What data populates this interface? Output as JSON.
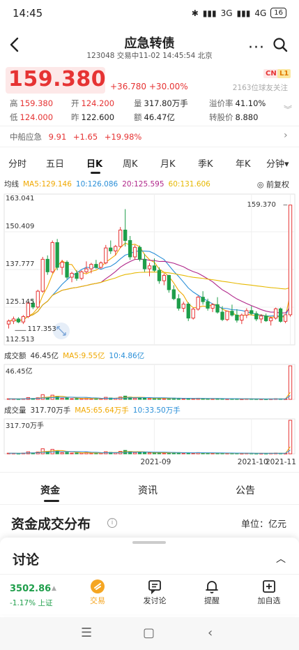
{
  "status_bar": {
    "time": "14:45",
    "network": "3G",
    "network2": "4G",
    "battery": "16"
  },
  "header": {
    "title": "应急转债",
    "subtitle": "123048 交易中11-02 14:45:54 北京"
  },
  "quote": {
    "price": "159.380",
    "change": "+36.780",
    "change_pct": "+30.00%",
    "tag_cn": "CN",
    "tag_l1": "L1",
    "followers": "2163位球友关注",
    "stats": [
      [
        {
          "k": "高",
          "v": "159.380",
          "c": "red"
        },
        {
          "k": "开",
          "v": "124.200",
          "c": "red"
        },
        {
          "k": "量",
          "v": "317.80万手",
          "c": "dark"
        },
        {
          "k": "溢价率",
          "v": "41.10%",
          "c": "dark"
        }
      ],
      [
        {
          "k": "低",
          "v": "124.000",
          "c": "red"
        },
        {
          "k": "昨",
          "v": "122.600",
          "c": "dark"
        },
        {
          "k": "额",
          "v": "46.47亿",
          "c": "dark"
        },
        {
          "k": "转股价",
          "v": "8.880",
          "c": "dark"
        }
      ]
    ]
  },
  "related": {
    "name": "中船应急",
    "price": "9.91",
    "change": "+1.65",
    "change_pct": "+19.98%"
  },
  "period_tabs": [
    "分时",
    "五日",
    "日K",
    "周K",
    "月K",
    "季K",
    "年K",
    "分钟"
  ],
  "period_active": 2,
  "period_more_caret": "▾",
  "ma_line": {
    "label": "均线",
    "items": [
      {
        "text": "MA5:129.146",
        "color": "#f0a800"
      },
      {
        "text": "10:126.086",
        "color": "#2a8fd8"
      },
      {
        "text": "20:125.595",
        "color": "#b0268a"
      },
      {
        "text": "60:131.606",
        "color": "#e6b800"
      }
    ],
    "adjust": "前复权"
  },
  "chart_data": [
    {
      "type": "candlestick",
      "y_ticks": [
        "163.041",
        "150.409",
        "137.777",
        "125.145",
        "112.513"
      ],
      "ylim": [
        112.513,
        163.041
      ],
      "max_label": "159.370",
      "min_label": "117.353",
      "x_ticks": [
        "2021-09",
        "2021-10",
        "2021-11"
      ],
      "ohlc": [
        [
          119.5,
          121.0,
          118.0,
          120.5
        ],
        [
          120.5,
          122.0,
          119.5,
          121.2
        ],
        [
          121.2,
          121.8,
          119.8,
          120.2
        ],
        [
          120.2,
          122.5,
          119.5,
          122.0
        ],
        [
          122.0,
          127.0,
          121.5,
          126.5
        ],
        [
          126.5,
          128.0,
          124.5,
          125.2
        ],
        [
          125.2,
          131.0,
          124.8,
          130.5
        ],
        [
          130.5,
          142.0,
          130.0,
          141.2
        ],
        [
          141.2,
          142.5,
          136.0,
          137.0
        ],
        [
          137.0,
          147.5,
          136.5,
          146.8
        ],
        [
          146.8,
          148.0,
          137.5,
          138.5
        ],
        [
          138.5,
          141.0,
          136.0,
          140.2
        ],
        [
          140.2,
          140.8,
          134.5,
          135.2
        ],
        [
          135.2,
          137.0,
          133.5,
          136.5
        ],
        [
          136.5,
          137.5,
          134.0,
          134.8
        ],
        [
          134.8,
          137.5,
          134.2,
          137.0
        ],
        [
          137.0,
          140.5,
          136.5,
          138.0
        ],
        [
          138.0,
          140.0,
          136.5,
          139.5
        ],
        [
          139.5,
          141.0,
          138.0,
          138.5
        ],
        [
          138.5,
          140.5,
          138.0,
          140.0
        ],
        [
          140.0,
          146.0,
          139.5,
          145.0
        ],
        [
          145.0,
          147.5,
          143.0,
          144.0
        ],
        [
          144.0,
          146.0,
          142.5,
          145.5
        ],
        [
          145.5,
          152.0,
          145.0,
          151.0
        ],
        [
          151.0,
          158.0,
          145.5,
          147.5
        ],
        [
          147.5,
          149.0,
          141.0,
          142.0
        ],
        [
          142.0,
          146.0,
          141.0,
          145.2
        ],
        [
          145.2,
          145.8,
          140.5,
          141.2
        ],
        [
          141.2,
          143.0,
          137.0,
          138.0
        ],
        [
          138.0,
          140.0,
          135.5,
          139.0
        ],
        [
          139.0,
          141.5,
          137.0,
          137.5
        ],
        [
          137.5,
          138.5,
          133.0,
          134.0
        ],
        [
          134.0,
          136.5,
          132.5,
          135.8
        ],
        [
          135.8,
          136.0,
          130.0,
          131.0
        ],
        [
          131.0,
          132.5,
          127.5,
          128.0
        ],
        [
          128.0,
          129.5,
          124.0,
          124.8
        ],
        [
          124.8,
          127.0,
          123.5,
          126.2
        ],
        [
          126.2,
          126.8,
          120.5,
          121.5
        ],
        [
          121.5,
          125.0,
          121.0,
          124.5
        ],
        [
          124.5,
          129.0,
          124.0,
          128.5
        ],
        [
          128.5,
          130.5,
          126.0,
          127.0
        ],
        [
          127.0,
          128.0,
          124.0,
          124.8
        ],
        [
          124.8,
          126.5,
          123.5,
          126.0
        ],
        [
          126.0,
          128.5,
          123.0,
          123.5
        ],
        [
          123.5,
          125.5,
          120.5,
          121.0
        ],
        [
          121.0,
          124.0,
          120.5,
          123.8
        ],
        [
          123.8,
          126.0,
          122.0,
          122.5
        ],
        [
          122.5,
          124.5,
          120.0,
          120.8
        ],
        [
          120.8,
          123.0,
          119.5,
          122.5
        ],
        [
          122.5,
          124.8,
          121.5,
          124.0
        ],
        [
          124.0,
          125.5,
          122.5,
          123.0
        ],
        [
          123.0,
          123.8,
          120.5,
          121.2
        ],
        [
          121.2,
          122.8,
          119.8,
          122.2
        ],
        [
          122.2,
          123.0,
          120.2,
          120.6
        ],
        [
          120.6,
          122.0,
          119.0,
          121.5
        ],
        [
          121.5,
          125.0,
          121.0,
          124.6
        ],
        [
          124.6,
          125.0,
          120.0,
          120.4
        ],
        [
          120.4,
          122.6,
          119.8,
          122.6
        ],
        [
          122.6,
          159.37,
          122.0,
          159.37
        ]
      ],
      "ma_series": [
        {
          "name": "MA5",
          "color": "#f0a800"
        },
        {
          "name": "MA10",
          "color": "#2a8fd8"
        },
        {
          "name": "MA20",
          "color": "#b0268a"
        },
        {
          "name": "MA60",
          "color": "#e6b800"
        }
      ]
    },
    {
      "type": "bar",
      "title": "成交额",
      "title_value": "46.45亿",
      "ma_labels": [
        {
          "text": "MA5:9.55亿",
          "color": "#f0a800"
        },
        {
          "text": "10:4.86亿",
          "color": "#2a8fd8"
        }
      ],
      "y_max_label": "46.45亿",
      "values": [
        0.8,
        0.7,
        0.6,
        0.9,
        2.5,
        1.2,
        2.2,
        6.5,
        3.0,
        5.8,
        4.2,
        1.5,
        1.8,
        1.0,
        1.1,
        1.2,
        1.6,
        1.0,
        0.9,
        1.2,
        2.8,
        1.9,
        1.5,
        3.2,
        4.5,
        3.1,
        1.6,
        1.9,
        2.0,
        1.2,
        1.1,
        1.8,
        1.0,
        1.6,
        1.7,
        1.5,
        0.9,
        1.3,
        0.8,
        1.5,
        1.2,
        0.9,
        0.7,
        1.0,
        1.0,
        0.6,
        0.7,
        0.7,
        0.5,
        0.8,
        0.7,
        0.6,
        0.5,
        0.5,
        0.6,
        0.9,
        0.7,
        0.6,
        46.45
      ]
    },
    {
      "type": "bar",
      "title": "成交量",
      "title_value": "317.70万手",
      "ma_labels": [
        {
          "text": "MA5:65.64万手",
          "color": "#f0a800"
        },
        {
          "text": "10:33.50万手",
          "color": "#2a8fd8"
        }
      ],
      "y_max_label": "317.70万手",
      "values": [
        6,
        5,
        4,
        7,
        19,
        9,
        17,
        48,
        22,
        42,
        30,
        11,
        13,
        7,
        8,
        9,
        12,
        7,
        6,
        9,
        20,
        14,
        11,
        23,
        32,
        22,
        12,
        14,
        14,
        9,
        8,
        13,
        7,
        12,
        12,
        11,
        7,
        10,
        6,
        11,
        9,
        7,
        5,
        7,
        7,
        5,
        5,
        5,
        4,
        6,
        5,
        4,
        4,
        4,
        5,
        7,
        5,
        4,
        317.7
      ]
    }
  ],
  "section_tabs": [
    "资金",
    "资讯",
    "公告"
  ],
  "section_active": 0,
  "fund": {
    "title": "资金成交分布",
    "unit": "单位：亿元"
  },
  "discussion": {
    "title": "讨论"
  },
  "bottom_bar": {
    "index_value": "3502.86",
    "index_change": "-1.17% 上证",
    "actions": [
      {
        "label": "交易",
        "icon": "trade-icon"
      },
      {
        "label": "发讨论",
        "icon": "comment-icon"
      },
      {
        "label": "提醒",
        "icon": "bell-icon"
      },
      {
        "label": "加自选",
        "icon": "add-box-icon"
      }
    ]
  },
  "colors": {
    "up": "#e63333",
    "down": "#1e9e4a",
    "accent": "#f5a623"
  }
}
